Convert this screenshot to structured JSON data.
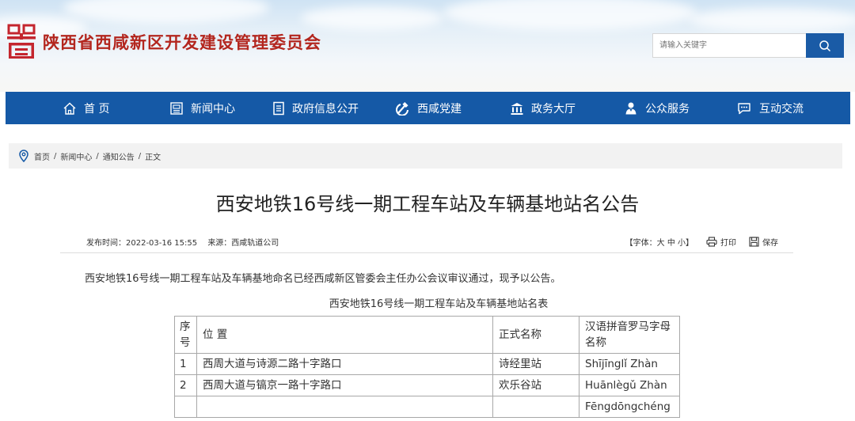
{
  "header": {
    "site_title": "陕西省西咸新区开发建设管理委员会",
    "search_placeholder": "请输入关键字"
  },
  "nav": [
    {
      "label": "首 页",
      "icon": "home-icon"
    },
    {
      "label": "新闻中心",
      "icon": "news-icon"
    },
    {
      "label": "政府信息公开",
      "icon": "document-icon"
    },
    {
      "label": "西咸党建",
      "icon": "party-emblem-icon"
    },
    {
      "label": "政务大厅",
      "icon": "government-hall-icon"
    },
    {
      "label": "公众服务",
      "icon": "user-service-icon"
    },
    {
      "label": "互动交流",
      "icon": "chat-icon"
    }
  ],
  "breadcrumb": {
    "items": [
      "首页",
      "新闻中心",
      "通知公告",
      "正文"
    ]
  },
  "article": {
    "title": "西安地铁16号线一期工程车站及车辆基地站名公告",
    "publish_time": "发布时间：2022-03-16 15:55",
    "source": "来源：西咸轨道公司",
    "font_size_prefix": "【字体：",
    "font_large": "大",
    "font_medium": "中",
    "font_small": "小",
    "font_size_suffix": "】",
    "print_label": "打印",
    "save_label": "保存",
    "paragraph": "西安地铁16号线一期工程车站及车辆基地命名已经西咸新区管委会主任办公会议审议通过，现予以公告。",
    "table_caption": "西安地铁16号线一期工程车站及车辆基地站名表",
    "table": {
      "headers": [
        "序号",
        "位 置",
        "正式名称",
        "汉语拼音罗马字母名称"
      ],
      "rows": [
        [
          "1",
          "西周大道与诗源二路十字路口",
          "诗经里站",
          "Shījīnglǐ Zhàn"
        ],
        [
          "2",
          "西周大道与镐京一路十字路口",
          "欢乐谷站",
          "Huānlègǔ Zhàn"
        ],
        [
          "",
          "",
          "",
          "Fēngdōngchéng"
        ]
      ]
    }
  }
}
